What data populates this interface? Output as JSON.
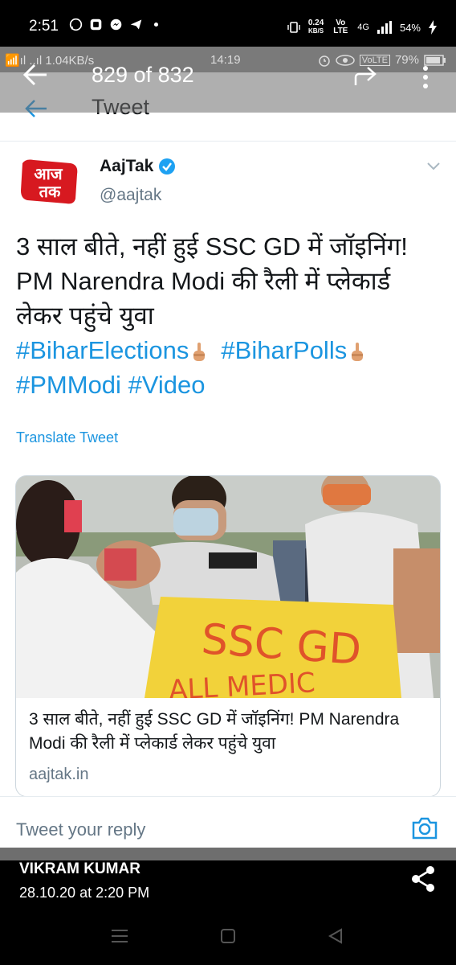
{
  "status_bar": {
    "time": "2:51",
    "speed_value": "0.24",
    "speed_unit": "KB/S",
    "volte": "Vo LTE",
    "network": "4G",
    "battery": "54%"
  },
  "inner_status": {
    "left": "📶ıl ..ıl 1.04KB/s",
    "time": "14:19",
    "volte": "VoLTE",
    "battery": "79%"
  },
  "gallery": {
    "counter": "829 of 832",
    "user": "VIKRAM KUMAR",
    "date": "28.10.20 at 2:20 PM"
  },
  "twitter_header": {
    "title": "Tweet"
  },
  "tweet": {
    "logo_text_top": "आज",
    "logo_text_bottom": "तक",
    "name": "AajTak",
    "handle": "@aajtak",
    "line1": "3 साल बीते, नहीं हुई SSC GD में जॉइनिंग!",
    "line2": "PM Narendra Modi की रैली में प्लेकार्ड",
    "line3": "लेकर पहुंचे युवा",
    "hashtag1": "#BiharElections",
    "hashtag2": "#BiharPolls",
    "hashtag3": "#PMModi",
    "hashtag4": "#Video",
    "translate_label": "Translate Tweet",
    "card": {
      "title": "3 साल बीते, नहीं हुई SSC GD में जॉइनिंग! PM Narendra Modi की रैली में प्लेकार्ड लेकर पहुंचे युवा",
      "domain": "aajtak.in",
      "placard_line1": "SSC GD",
      "placard_line2": "ALL MEDIC"
    }
  },
  "reply": {
    "placeholder": "Tweet your reply"
  },
  "colors": {
    "twitter_blue": "#1b95e0",
    "aajtak_red": "#d71920",
    "text_dark": "#14171a",
    "text_muted": "#657786"
  }
}
